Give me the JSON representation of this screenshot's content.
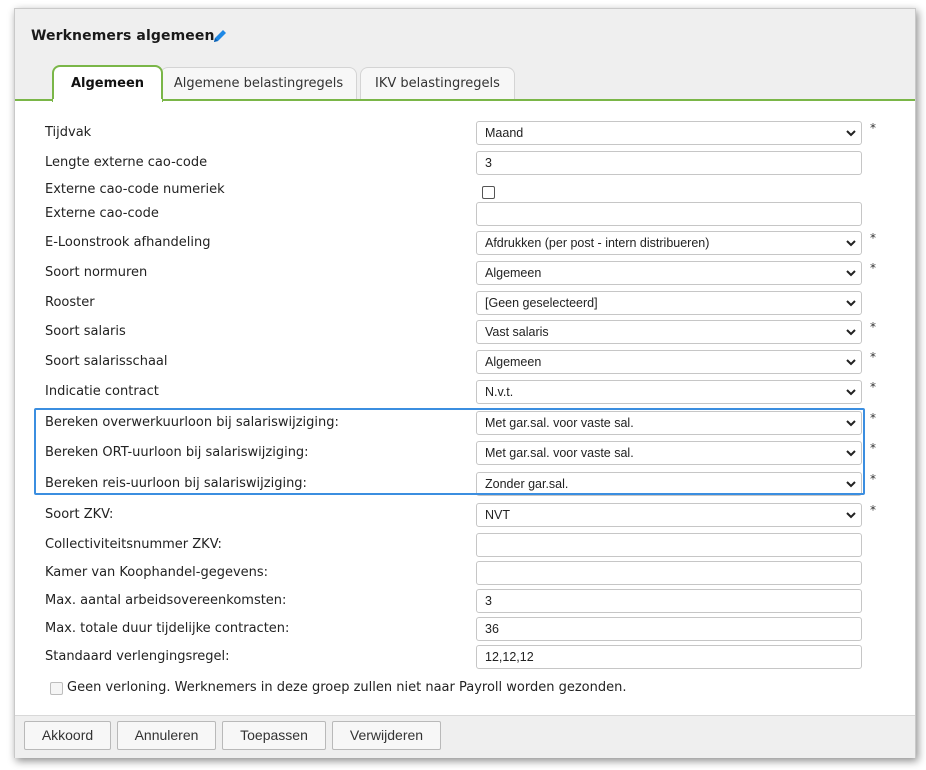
{
  "header": {
    "title": "Werknemers algemeen"
  },
  "tabs": [
    {
      "label": "Algemeen",
      "active": true
    },
    {
      "label": "Algemene belastingregels",
      "active": false
    },
    {
      "label": "IKV belastingregels",
      "active": false
    }
  ],
  "fields": {
    "tijdvak": {
      "label": "Tijdvak",
      "value": "Maand",
      "required": "*"
    },
    "lengte_cao": {
      "label": "Lengte externe cao-code",
      "value": "3"
    },
    "cao_numeriek": {
      "label": "Externe cao-code numeriek",
      "checked": false
    },
    "externe_cao": {
      "label": "Externe cao-code",
      "value": ""
    },
    "eloonstrook": {
      "label": "E-Loonstrook afhandeling",
      "value": "Afdrukken (per post - intern distribueren)",
      "required": "*"
    },
    "normuren": {
      "label": "Soort normuren",
      "value": "Algemeen",
      "required": "*"
    },
    "rooster": {
      "label": "Rooster",
      "value": "[Geen geselecteerd]"
    },
    "salaris": {
      "label": "Soort salaris",
      "value": "Vast salaris",
      "required": "*"
    },
    "salarisschaal": {
      "label": "Soort salarisschaal",
      "value": "Algemeen",
      "required": "*"
    },
    "contract": {
      "label": "Indicatie contract",
      "value": "N.v.t.",
      "required": "*"
    },
    "overwerk": {
      "label": "Bereken overwerkuurloon bij salariswijziging:",
      "value": "Met gar.sal. voor vaste sal.",
      "required": "*"
    },
    "ort": {
      "label": "Bereken ORT-uurloon bij salariswijziging:",
      "value": "Met gar.sal. voor vaste sal.",
      "required": "*"
    },
    "reis": {
      "label": "Bereken reis-uurloon bij salariswijziging:",
      "value": "Zonder gar.sal.",
      "required": "*"
    },
    "zkv": {
      "label": "Soort ZKV:",
      "value": "NVT",
      "required": "*"
    },
    "collectiviteit": {
      "label": "Collectiviteitsnummer ZKV:",
      "value": ""
    },
    "kvk": {
      "label": "Kamer van Koophandel-gegevens:",
      "value": ""
    },
    "max_arbeid": {
      "label": "Max. aantal arbeidsovereenkomsten:",
      "value": "3"
    },
    "max_duur": {
      "label": "Max. totale duur tijdelijke contracten:",
      "value": "36"
    },
    "verlenging": {
      "label": "Standaard verlengingsregel:",
      "value": "12,12,12"
    }
  },
  "geen_verloning": {
    "label": "Geen verloning. Werknemers in deze groep zullen niet naar Payroll worden gezonden.",
    "checked": false
  },
  "buttons": {
    "akkoord": "Akkoord",
    "annuleren": "Annuleren",
    "toepassen": "Toepassen",
    "verwijderen": "Verwijderen"
  },
  "colors": {
    "accent_green": "#7ab648",
    "highlight_blue": "#3b8ee0",
    "pencil_blue": "#1e88e5"
  },
  "icons": {
    "edit": "pencil-icon",
    "dropdown": "chevron-down-icon"
  }
}
